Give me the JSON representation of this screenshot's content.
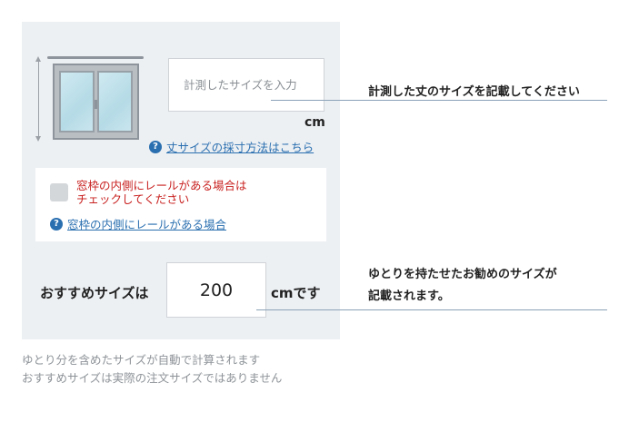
{
  "size_input": {
    "placeholder": "計測したサイズを入力",
    "unit": "cm"
  },
  "help_link_measure": {
    "label": "丈サイズの採寸方法はこちら"
  },
  "rail_option": {
    "checkbox_line1": "窓枠の内側にレールがある場合は",
    "checkbox_line2": "チェックしてください",
    "help_label": "窓枠の内側にレールがある場合"
  },
  "recommended": {
    "label": "おすすめサイズは",
    "value": "200",
    "unit": "cmです"
  },
  "annotations": {
    "size_note": "計測した丈のサイズを記載してください",
    "recommend_note_line1": "ゆとりを持たせたお勧めのサイズが",
    "recommend_note_line2": "記載されます。"
  },
  "footnote": {
    "line1": "ゆとり分を含めたサイズが自動で計算されます",
    "line2": "おすすめサイズは実際の注文サイズではありません"
  },
  "colors": {
    "panel_bg": "#edf0f3",
    "link": "#2a6fb0",
    "warning_text": "#c8201f"
  }
}
